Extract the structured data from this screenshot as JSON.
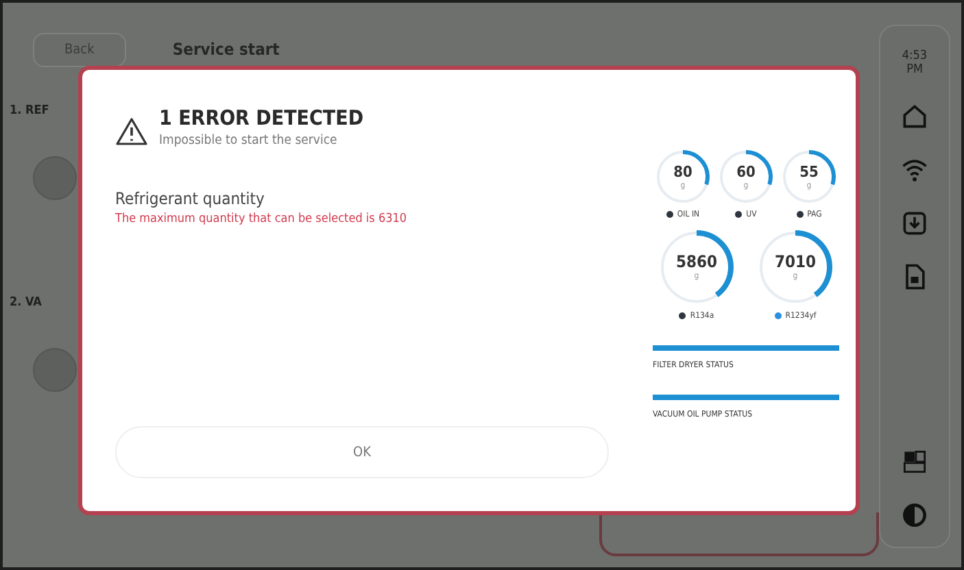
{
  "header": {
    "back": "Back",
    "title": "Service start"
  },
  "sections": [
    {
      "label": "1. REF"
    },
    {
      "label": "2. VA"
    }
  ],
  "sidebar": {
    "time": "4:53",
    "period": "PM"
  },
  "dialog": {
    "title": "1 ERROR DETECTED",
    "subtitle": "Impossible to start the service",
    "errors": [
      {
        "field": "Refrigerant quantity",
        "message": "The maximum quantity that can be selected is 6310"
      }
    ],
    "button": "OK",
    "gauges": [
      {
        "kind": "small",
        "value": "80",
        "unit": "g",
        "label": "OIL IN",
        "level": 0.3,
        "color": "#2f3640"
      },
      {
        "kind": "small",
        "value": "60",
        "unit": "g",
        "label": "UV",
        "level": 0.3,
        "color": "#2f3640"
      },
      {
        "kind": "small",
        "value": "55",
        "unit": "g",
        "label": "PAG",
        "level": 0.3,
        "color": "#2f3640"
      },
      {
        "kind": "large",
        "value": "5860",
        "unit": "g",
        "label": "R134a",
        "level": 0.4,
        "color": "#2f3640"
      },
      {
        "kind": "large",
        "value": "7010",
        "unit": "g",
        "label": "R1234yf",
        "level": 0.4,
        "color": "#2b8fe0"
      }
    ],
    "statuses": [
      {
        "label": "FILTER DRYER STATUS",
        "level": 1
      },
      {
        "label": "VACUUM OIL PUMP STATUS",
        "level": 1
      }
    ]
  }
}
